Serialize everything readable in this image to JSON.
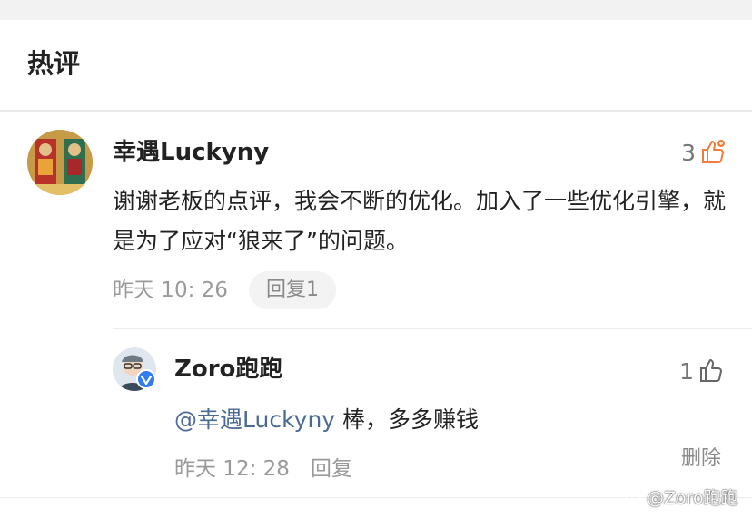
{
  "section": {
    "title": "热评"
  },
  "comment": {
    "username": "幸遇Luckyny",
    "likes": "3",
    "text": "谢谢老板的点评，我会不断的优化。加入了一些优化引擎，就是为了应对“狼来了”的问题。",
    "time": "昨天 10: 26",
    "reply_button": "回复1",
    "liked": true,
    "accent_color": "#f07d3c"
  },
  "reply": {
    "username": "Zoro跑跑",
    "likes": "1",
    "mention": "@幸遇Luckyny",
    "text": " 棒，多多赚钱",
    "time": "昨天 12: 28",
    "reply_label": "回复",
    "delete_label": "删除",
    "verified_badge_color": "#2f7df1"
  },
  "watermark": {
    "text": "@Zoro跑跑"
  }
}
